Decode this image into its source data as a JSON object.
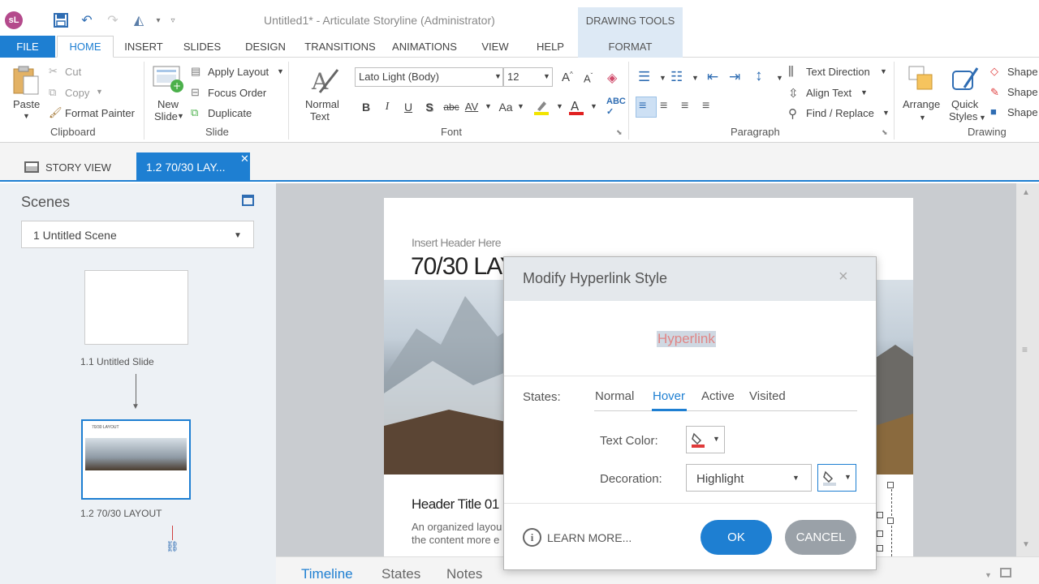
{
  "window": {
    "title": "Untitled1* -  Articulate Storyline (Administrator)",
    "logo": "sL"
  },
  "ribbon_tabs": {
    "file": "FILE",
    "home": "HOME",
    "insert": "INSERT",
    "slides": "SLIDES",
    "design": "DESIGN",
    "transitions": "TRANSITIONS",
    "animations": "ANIMATIONS",
    "view": "VIEW",
    "help": "HELP",
    "drawing_tools": "DRAWING TOOLS",
    "format": "FORMAT"
  },
  "clipboard": {
    "paste": "Paste",
    "cut": "Cut",
    "copy": "Copy",
    "format_painter": "Format Painter",
    "group": "Clipboard"
  },
  "slide_group": {
    "new_slide_1": "New",
    "new_slide_2": "Slide",
    "apply_layout": "Apply Layout",
    "focus_order": "Focus Order",
    "duplicate": "Duplicate",
    "group": "Slide"
  },
  "normal_text": {
    "line1": "Normal",
    "line2": "Text"
  },
  "font": {
    "name": "Lato Light (Body)",
    "size": "12",
    "group": "Font",
    "bold": "B",
    "italic": "I",
    "underline": "U",
    "shadow": "S",
    "strike": "abc",
    "spacing": "AV",
    "case": "Aa",
    "grow": "A",
    "shrink": "A"
  },
  "paragraph": {
    "text_direction": "Text Direction",
    "align_text": "Align Text",
    "find_replace": "Find / Replace",
    "group": "Paragraph"
  },
  "drawing": {
    "arrange": "Arrange",
    "quick_styles_1": "Quick",
    "quick_styles_2": "Styles",
    "shape": "Shape",
    "group": "Drawing"
  },
  "tabs": {
    "story_view": "STORY VIEW",
    "slide_tab": "1.2 70/30 LAY..."
  },
  "scenes": {
    "title": "Scenes",
    "selected": "1 Untitled Scene",
    "slide1": "1.1 Untitled Slide",
    "slide2": "1.2 70/30 LAYOUT"
  },
  "slide": {
    "insert_header": "Insert Header Here",
    "title": "70/30 LAYO",
    "header_title": "Header Title 01",
    "body_1": "An organized layou",
    "body_2": "the content more e"
  },
  "bottom_tabs": {
    "timeline": "Timeline",
    "states": "States",
    "notes": "Notes"
  },
  "dialog": {
    "title": "Modify Hyperlink Style",
    "close": "×",
    "preview": "Hyperlink",
    "states_label": "States:",
    "states": [
      "Normal",
      "Hover",
      "Active",
      "Visited"
    ],
    "active_state": "Hover",
    "text_color_label": "Text Color:",
    "decoration_label": "Decoration:",
    "decoration_value": "Highlight",
    "learn_more": "LEARN MORE...",
    "ok": "OK",
    "cancel": "CANCEL"
  },
  "colors": {
    "accent": "#1e7fd2",
    "file_tab": "#1e7fd2",
    "hyperlink_hover": "#e08585",
    "highlight": "#cfd8e2",
    "text_color_swatch": "#e03a3a"
  }
}
